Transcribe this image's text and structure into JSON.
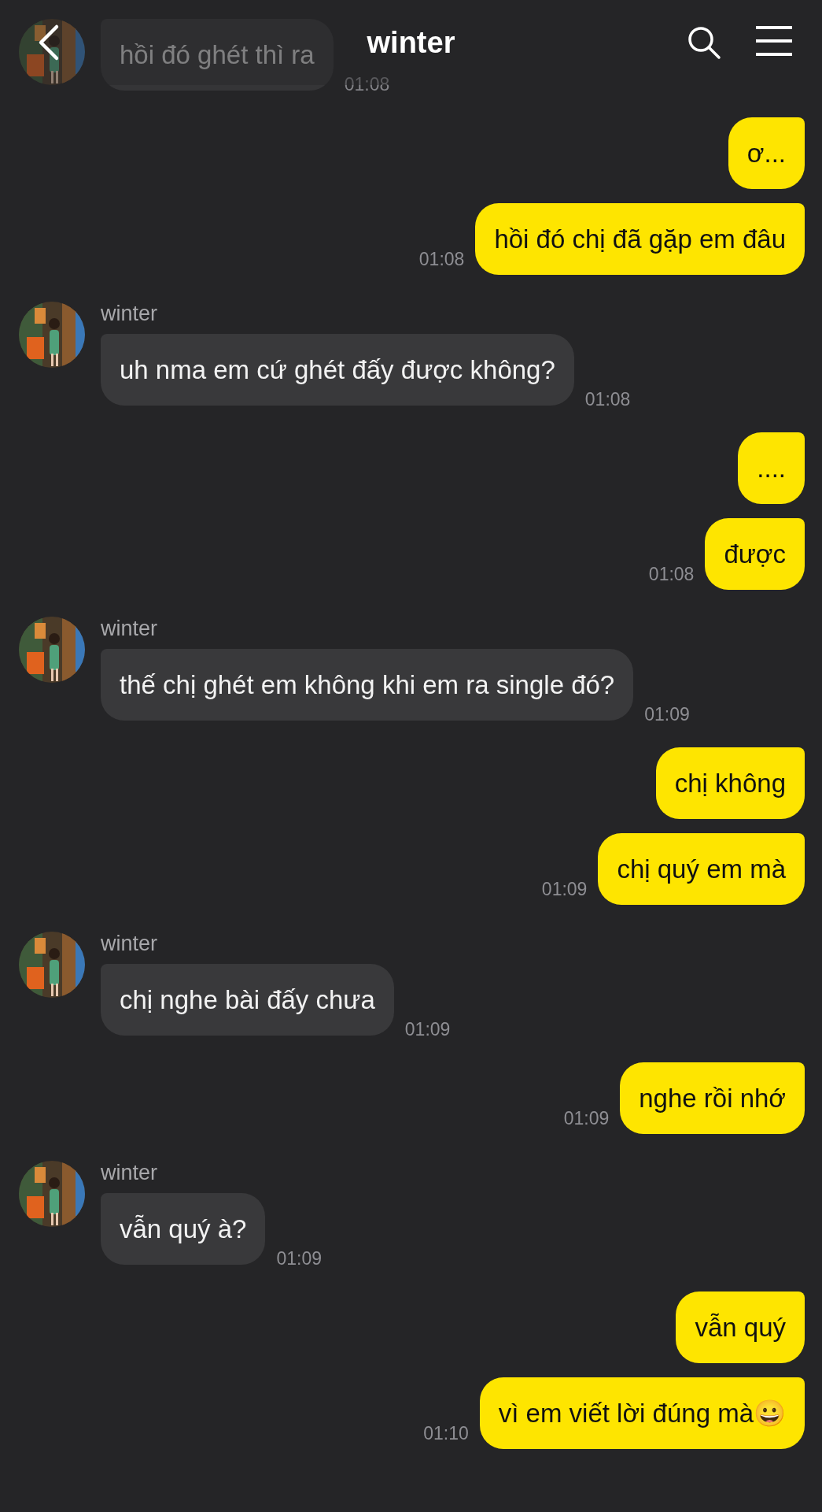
{
  "header": {
    "title": "winter"
  },
  "groups": [
    {
      "kind": "incoming",
      "bubbles": [
        "hồi đó ghét thì ra"
      ],
      "time": "01:08"
    },
    {
      "kind": "outgoing",
      "bubbles": [
        "ơ...",
        "hồi đó chị đã gặp em đâu"
      ],
      "time": "01:08"
    },
    {
      "kind": "incoming",
      "name": "winter",
      "bubbles": [
        "uh nma em cứ ghét đấy được không?"
      ],
      "time": "01:08"
    },
    {
      "kind": "outgoing",
      "bubbles": [
        "....",
        "được"
      ],
      "time": "01:08"
    },
    {
      "kind": "incoming",
      "name": "winter",
      "bubbles": [
        "thế chị ghét em không khi em ra single đó?"
      ],
      "time": "01:09"
    },
    {
      "kind": "outgoing",
      "bubbles": [
        "chị không",
        "chị quý em mà"
      ],
      "time": "01:09"
    },
    {
      "kind": "incoming",
      "name": "winter",
      "bubbles": [
        "chị nghe bài đấy chưa"
      ],
      "time": "01:09"
    },
    {
      "kind": "outgoing",
      "bubbles": [
        "nghe rồi nhớ"
      ],
      "time": "01:09"
    },
    {
      "kind": "incoming",
      "name": "winter",
      "bubbles": [
        "vẫn quý à?"
      ],
      "time": "01:09"
    },
    {
      "kind": "outgoing",
      "bubbles": [
        "vẫn quý",
        "vì em viết lời đúng mà😀"
      ],
      "time": "01:10"
    }
  ]
}
